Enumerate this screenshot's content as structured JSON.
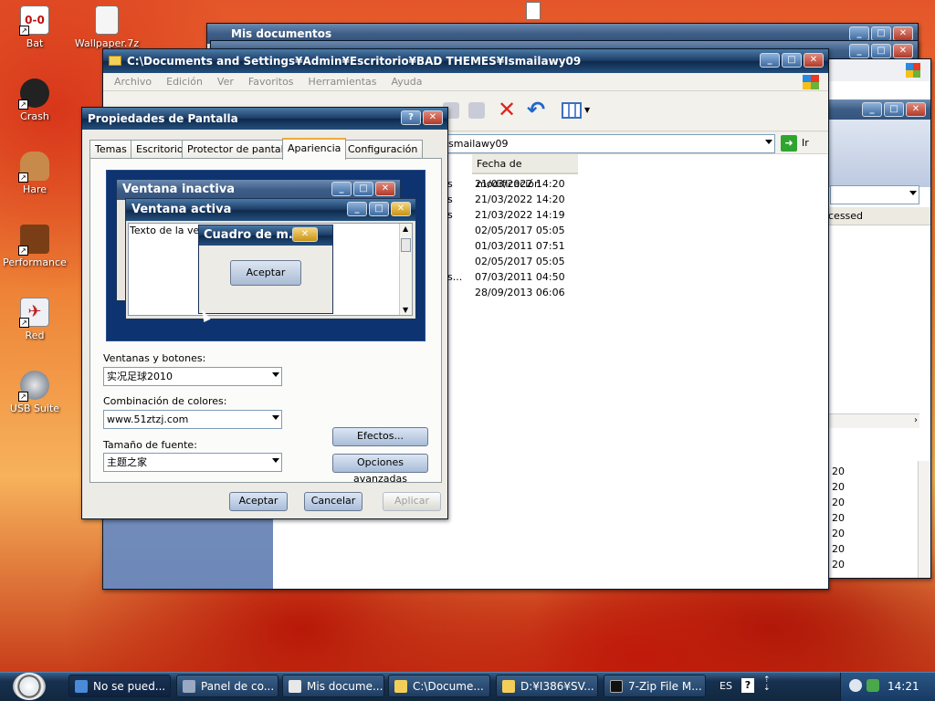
{
  "desktop": {
    "icons": [
      {
        "label": "Bat"
      },
      {
        "label": "Wallpaper.7z"
      },
      {
        "label": "Crash"
      },
      {
        "label": "Hare"
      },
      {
        "label": "Performance"
      },
      {
        "label": "Red"
      },
      {
        "label": "USB Suite"
      }
    ]
  },
  "bg_window_mis": {
    "title": "Mis documentos"
  },
  "explorer": {
    "title": "C:\\Documents and Settings¥Admin¥Escritorio¥BAD THEMES¥Ismailawy09",
    "menu": [
      "Archivo",
      "Edición",
      "Ver",
      "Favoritos",
      "Herramientas",
      "Ayuda"
    ],
    "address_value": "smailawy09",
    "go_label": "Ir",
    "column_header": "Fecha de modificación",
    "rows": [
      {
        "frag": "s",
        "date": "21/03/2022 14:20"
      },
      {
        "frag": "s",
        "date": "21/03/2022 14:20"
      },
      {
        "frag": "s",
        "date": "21/03/2022 14:19"
      },
      {
        "frag": "",
        "date": "02/05/2017 05:05"
      },
      {
        "frag": "",
        "date": "01/03/2011 07:51"
      },
      {
        "frag": "",
        "date": "02/05/2017 05:05"
      },
      {
        "frag": "s...",
        "date": "07/03/2011 04:50"
      },
      {
        "frag": "",
        "date": "28/09/2013 06:06"
      }
    ]
  },
  "right_window": {
    "header_fragment": "cessed",
    "values": [
      "20",
      "20",
      "20",
      "20",
      "20",
      "20",
      "20",
      "20"
    ]
  },
  "dialog": {
    "title": "Propiedades de Pantalla",
    "help": "?",
    "tabs": [
      "Temas",
      "Escritorio",
      "Protector de pantalla",
      "Apariencia",
      "Configuración"
    ],
    "selected_tab": "Apariencia",
    "preview": {
      "inactive_title": "Ventana inactiva",
      "active_title": "Ventana activa",
      "window_text": "Texto de la vent",
      "msgbox_title": "Cuadro de m...",
      "msgbox_button": "Aceptar"
    },
    "windows_buttons_label": "Ventanas y botones:",
    "windows_buttons_value": "实况足球2010",
    "color_scheme_label": "Combinación de colores:",
    "color_scheme_value": "www.51ztzj.com",
    "font_size_label": "Tamaño de fuente:",
    "font_size_value": "主题之家",
    "effects_button": "Efectos...",
    "advanced_button": "Opciones avanzadas",
    "ok_button": "Aceptar",
    "cancel_button": "Cancelar",
    "apply_button": "Aplicar"
  },
  "taskbar": {
    "items": [
      {
        "label": "No se pued..."
      },
      {
        "label": "Panel de co..."
      },
      {
        "label": "Mis docume..."
      },
      {
        "label": "C:\\Docume..."
      },
      {
        "label": "D:¥I386¥SV..."
      },
      {
        "label": "7-Zip File M..."
      }
    ],
    "language": "ES",
    "help": "?",
    "clock": "14:21"
  },
  "colors": {
    "accent": "#f0a93a",
    "title_active": "#1c3c66",
    "taskbar": "#16304f"
  }
}
